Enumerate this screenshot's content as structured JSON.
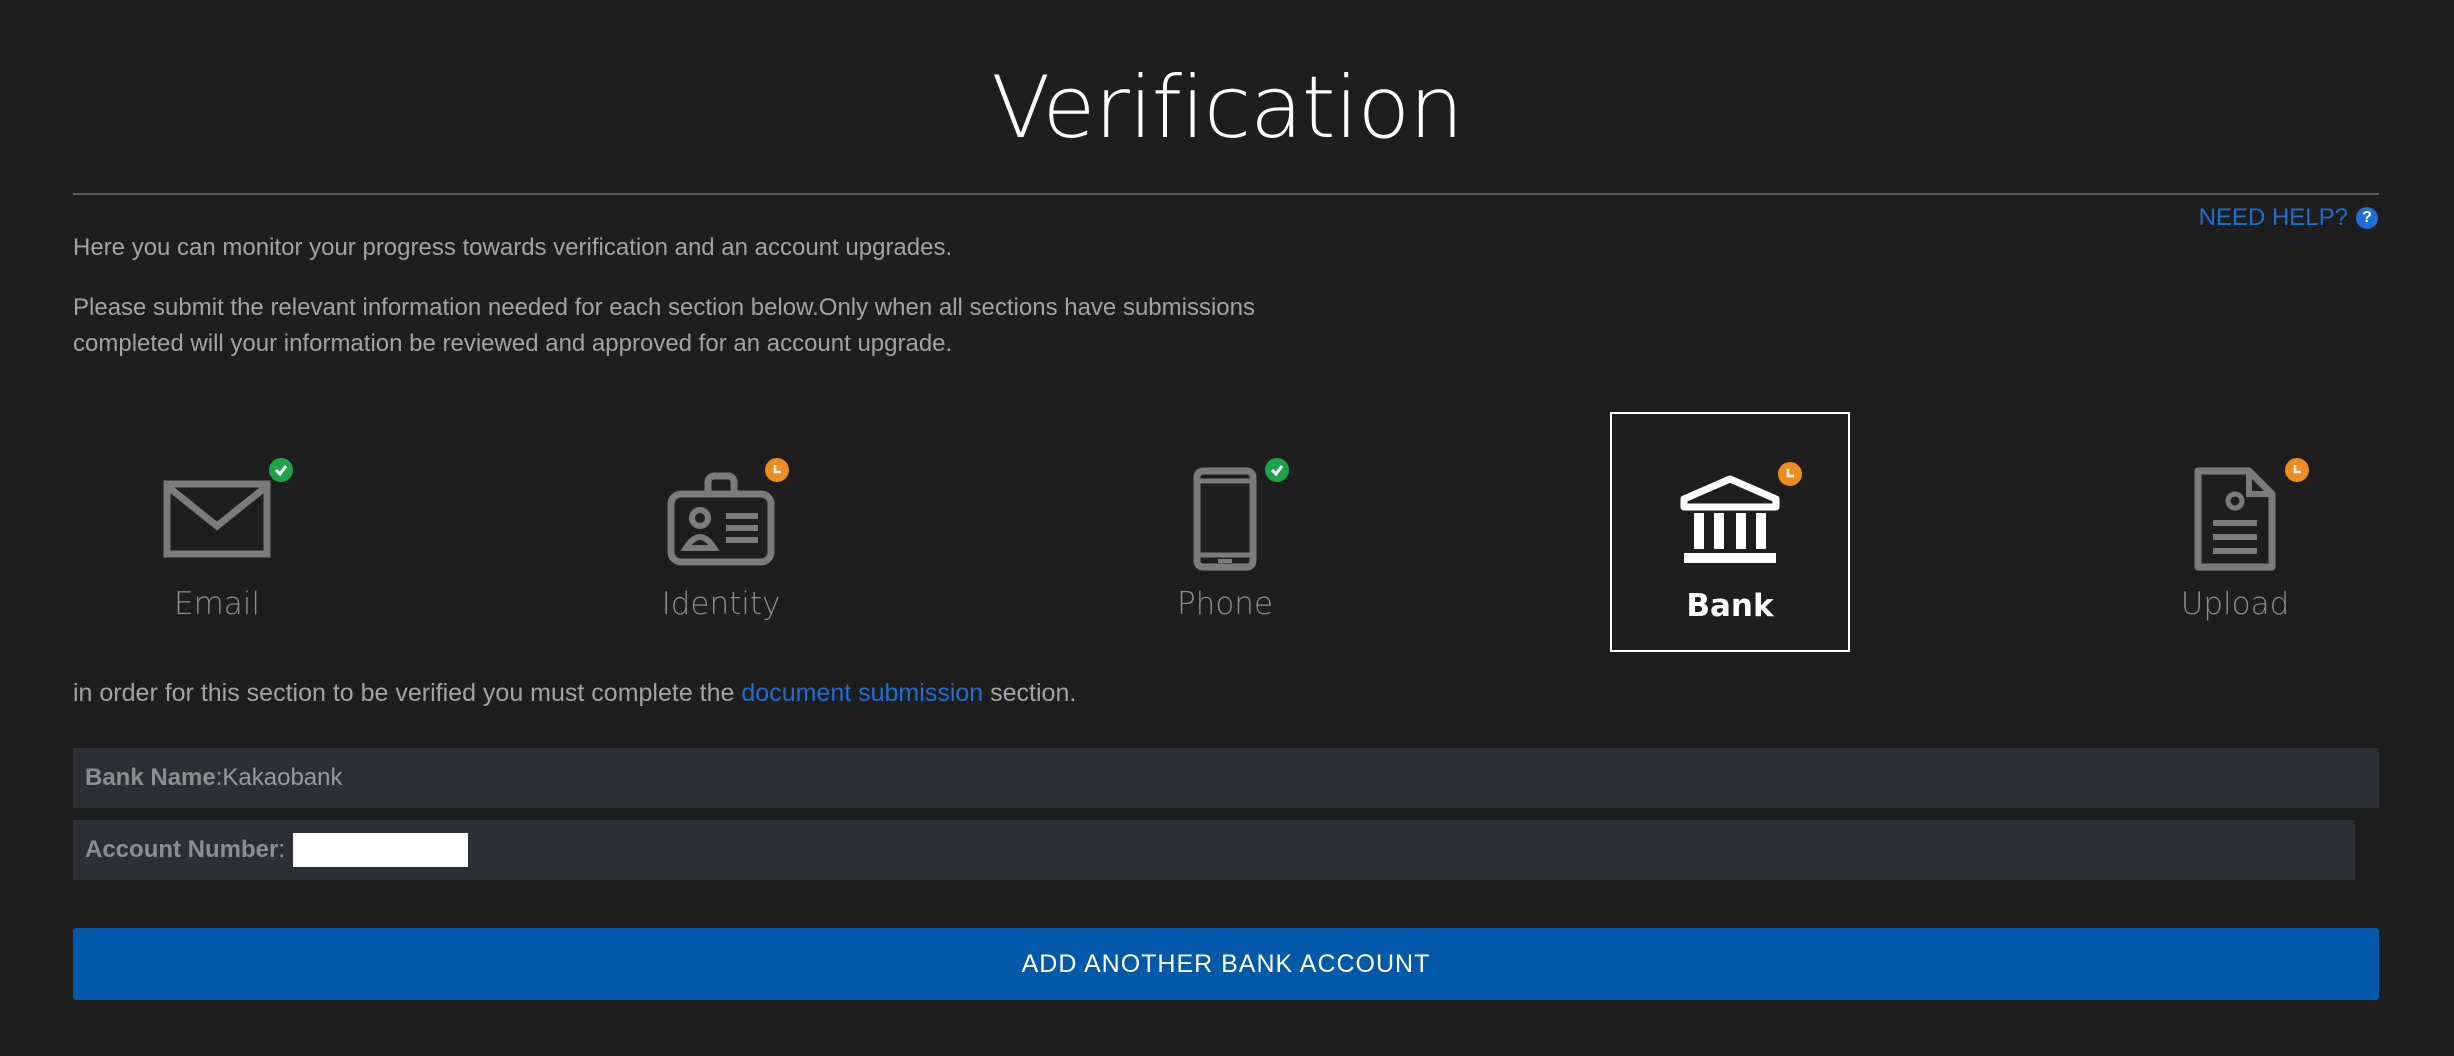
{
  "title": "Verification",
  "help": {
    "label": "NEED HELP?",
    "icon": "question-icon"
  },
  "intro": {
    "line1": "Here you can monitor your progress towards verification and an account upgrades.",
    "line2": "Please submit the relevant information needed for each section below.Only when all sections have submissions completed will your information be reviewed and approved for an account upgrade."
  },
  "steps": [
    {
      "label": "Email",
      "icon": "envelope-icon",
      "status": "complete",
      "active": false
    },
    {
      "label": "Identity",
      "icon": "id-card-icon",
      "status": "pending",
      "active": false
    },
    {
      "label": "Phone",
      "icon": "phone-icon",
      "status": "complete",
      "active": false
    },
    {
      "label": "Bank",
      "icon": "bank-icon",
      "status": "pending",
      "active": true
    },
    {
      "label": "Upload",
      "icon": "document-icon",
      "status": "pending",
      "active": false
    }
  ],
  "colors": {
    "complete": "#1fa34a",
    "pending": "#f08c1e",
    "accent": "#1f6ed4",
    "button": "#0559ab"
  },
  "note": {
    "before": "in order for this section to be verified you must complete the ",
    "link": "document submission",
    "after": " section."
  },
  "bank": {
    "name_label": "Bank Name",
    "name_value": "Kakaobank",
    "account_label": "Account Number"
  },
  "add_button": "ADD ANOTHER BANK ACCOUNT"
}
